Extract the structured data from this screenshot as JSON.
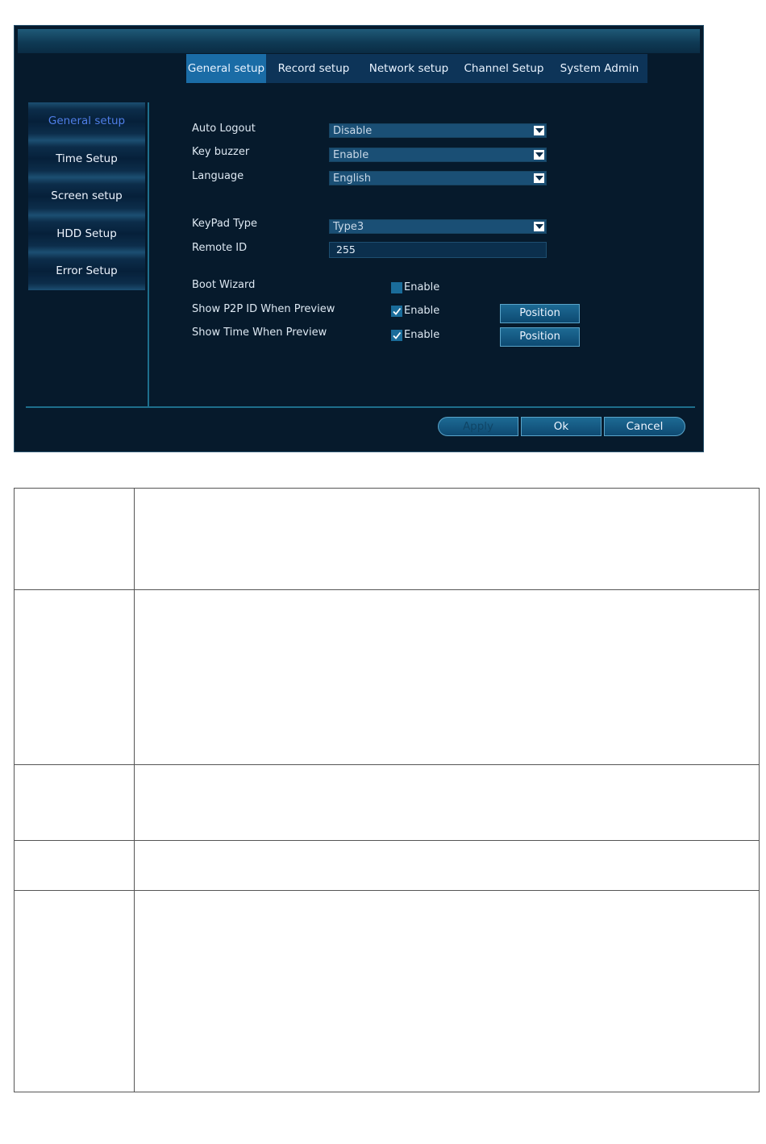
{
  "tabs": [
    {
      "label": "General setup",
      "active": true
    },
    {
      "label": "Record setup",
      "active": false
    },
    {
      "label": "Network setup",
      "active": false
    },
    {
      "label": "Channel Setup",
      "active": false
    },
    {
      "label": "System Admin",
      "active": false
    }
  ],
  "sidebar": {
    "items": [
      {
        "label": "General setup",
        "active": true
      },
      {
        "label": "Time Setup",
        "active": false
      },
      {
        "label": "Screen setup",
        "active": false
      },
      {
        "label": "HDD Setup",
        "active": false
      },
      {
        "label": "Error Setup",
        "active": false
      }
    ]
  },
  "form": {
    "auto_logout": {
      "label": "Auto Logout",
      "value": "Disable"
    },
    "key_buzzer": {
      "label": "Key buzzer",
      "value": "Enable"
    },
    "language": {
      "label": "Language",
      "value": "English"
    },
    "keypad_type": {
      "label": "KeyPad Type",
      "value": "Type3"
    },
    "remote_id": {
      "label": "Remote ID",
      "value": "255"
    },
    "boot_wizard": {
      "label": "Boot Wizard",
      "check_label": "Enable",
      "checked": false
    },
    "show_p2p_id": {
      "label": "Show P2P ID When Preview",
      "check_label": "Enable",
      "checked": true,
      "button": "Position"
    },
    "show_time": {
      "label": "Show Time When Preview",
      "check_label": "Enable",
      "checked": true,
      "button": "Position"
    }
  },
  "footer": {
    "apply_label": "Apply",
    "ok_label": "Ok",
    "cancel_label": "Cancel"
  },
  "colors": {
    "window_bg": "#061a2c",
    "tab_active": "#1a6ca6",
    "sidebar_active_text": "#4f7fe8",
    "accent_line": "#1e6e8c"
  },
  "doc_table": {
    "rows": [
      {
        "cells": [
          "",
          ""
        ]
      },
      {
        "cells": [
          "",
          ""
        ]
      },
      {
        "cells": [
          "",
          ""
        ]
      },
      {
        "cells": [
          "",
          ""
        ]
      },
      {
        "cells": [
          "",
          ""
        ]
      }
    ]
  }
}
